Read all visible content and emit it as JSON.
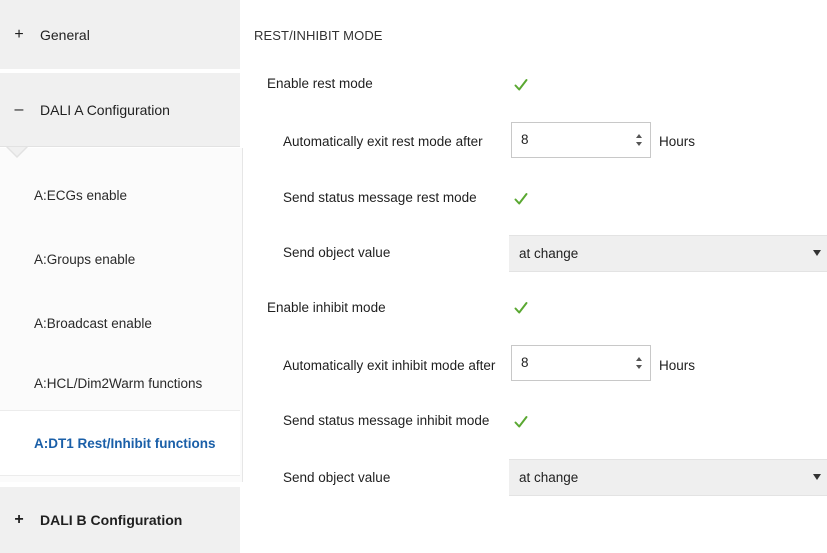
{
  "sidebar": {
    "general": {
      "sign": "+",
      "label": "General"
    },
    "dali_a": {
      "sign": "–",
      "label": "DALI A Configuration"
    },
    "dali_a_items": [
      {
        "label": "A:ECGs enable"
      },
      {
        "label": "A:Groups enable"
      },
      {
        "label": "A:Broadcast enable"
      },
      {
        "label": "A:HCL/Dim2Warm functions"
      },
      {
        "label": "A:DT1 Rest/Inhibit functions",
        "selected": true
      }
    ],
    "dali_b": {
      "sign": "+",
      "label": "DALI B Configuration"
    }
  },
  "main": {
    "section_title": "REST/INHIBIT MODE",
    "rest": {
      "enable_label": "Enable rest mode",
      "enable_checked": true,
      "auto_exit_label": "Automatically exit rest mode after",
      "auto_exit_value": "8",
      "auto_exit_unit": "Hours",
      "status_label": "Send status message rest mode",
      "status_checked": true,
      "send_label": "Send object value",
      "send_value": "at change"
    },
    "inhibit": {
      "enable_label": "Enable inhibit mode",
      "enable_checked": true,
      "auto_exit_label": "Automatically exit inhibit mode after",
      "auto_exit_value": "8",
      "auto_exit_unit": "Hours",
      "status_label": "Send status message inhibit mode",
      "status_checked": true,
      "send_label": "Send object value",
      "send_value": "at change"
    }
  },
  "colors": {
    "accent_selected": "#1a5fa8",
    "checkmark": "#5aa832",
    "nav_bg": "#f0f0f0",
    "dropdown_bg": "#efefef"
  },
  "icons": {
    "checkmark": "check-icon",
    "spinner": "spin-arrows-icon",
    "dropdown": "chevron-down-icon"
  }
}
